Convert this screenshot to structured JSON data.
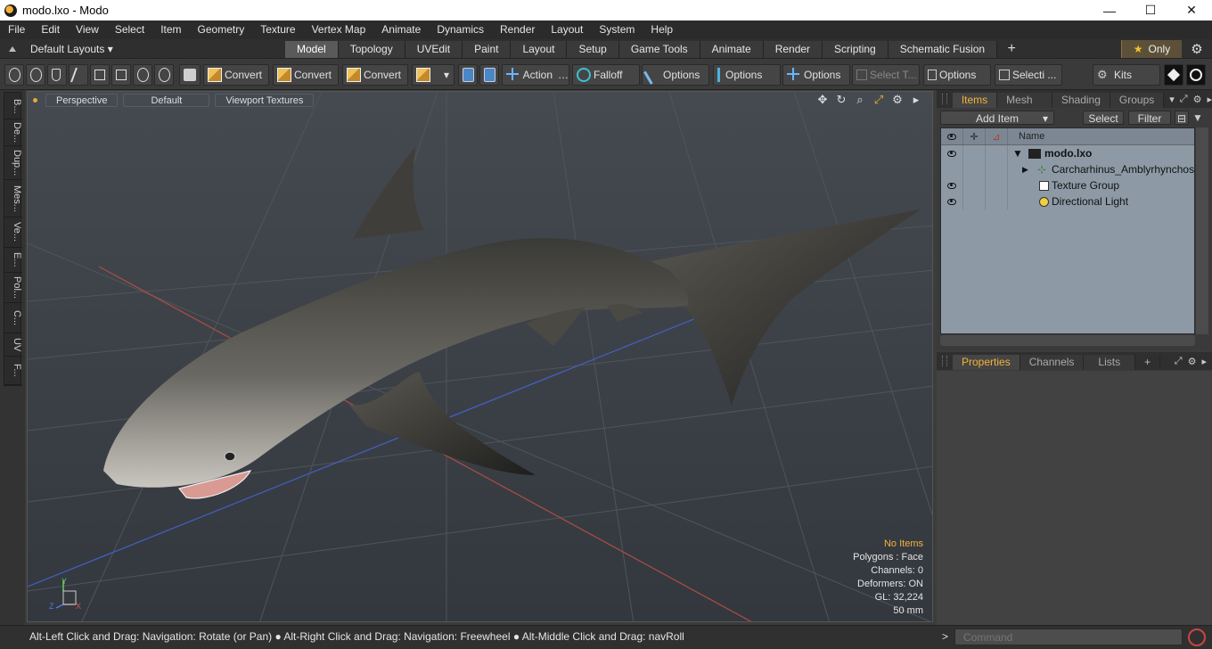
{
  "window": {
    "title": "modo.lxo - Modo",
    "minimize": "—",
    "maximize": "☐",
    "close": "✕"
  },
  "menubar": [
    "File",
    "Edit",
    "View",
    "Select",
    "Item",
    "Geometry",
    "Texture",
    "Vertex Map",
    "Animate",
    "Dynamics",
    "Render",
    "Layout",
    "System",
    "Help"
  ],
  "layoutbar": {
    "layouts_label": "Default Layouts ▾",
    "tabs": [
      "Model",
      "Topology",
      "UVEdit",
      "Paint",
      "Layout",
      "Setup",
      "Game Tools",
      "Animate",
      "Render",
      "Scripting",
      "Schematic Fusion"
    ],
    "active_tab": "Model",
    "plus": "+",
    "only_label": "Only",
    "star": "★",
    "gear": "⚙"
  },
  "toolbar": {
    "convert_1": "Convert",
    "convert_2": "Convert",
    "convert_3": "Convert",
    "action": "Action",
    "falloff": "Falloff",
    "options_1": "Options",
    "options_2": "Options",
    "options_3": "Options",
    "select_t": "Select T...",
    "options_4": "Options",
    "selecti": "Selecti ...",
    "kits": "Kits",
    "ellipsis": "…",
    "dropdown": "▾"
  },
  "leftbar": [
    "B...",
    "De...",
    "Dup...",
    "Mes...",
    "Ve...",
    "E...",
    "Pol...",
    "C...",
    "UV",
    "F..."
  ],
  "viewport": {
    "view_mode": "Perspective",
    "shading": "Default",
    "textures": "Viewport Textures",
    "tools": [
      "✥",
      "↻",
      "⌕",
      "⤢",
      "⚙",
      "▸"
    ],
    "info": {
      "no_items": "No Items",
      "polygons": "Polygons : Face",
      "channels": "Channels: 0",
      "deformers": "Deformers: ON",
      "gl": "GL: 32,224",
      "focal": "50 mm"
    },
    "axis_labels": {
      "y": "Y",
      "x": "X",
      "z": "Z"
    }
  },
  "items_panel": {
    "tabs": [
      "Items",
      "Mesh ...",
      "Shading",
      "Groups"
    ],
    "active": "Items",
    "add_item": "Add Item",
    "add_item_arrow": "▾",
    "select": "Select",
    "filter": "Filter",
    "name_header": "Name",
    "tree": [
      {
        "name": "modo.lxo",
        "eye": true,
        "indent": 0,
        "expander": "▼",
        "icon": "scene-icon"
      },
      {
        "name": "Carcharhinus_Amblyrhynchos ...",
        "eye": false,
        "indent": 1,
        "expander": "▶",
        "icon": "locator-icon"
      },
      {
        "name": "Texture Group",
        "eye": true,
        "indent": 1,
        "expander": "",
        "icon": "texture-group-icon"
      },
      {
        "name": "Directional Light",
        "eye": true,
        "indent": 1,
        "expander": "",
        "icon": "light-icon"
      }
    ]
  },
  "props_panel": {
    "tabs": [
      "Properties",
      "Channels",
      "Lists"
    ],
    "active": "Properties",
    "plus": "+"
  },
  "statusbar": {
    "hint": "Alt-Left Click and Drag: Navigation: Rotate (or Pan) ● Alt-Right Click and Drag: Navigation: Freewheel ● Alt-Middle Click and Drag: navRoll",
    "prompt": ">",
    "command_placeholder": "Command"
  }
}
